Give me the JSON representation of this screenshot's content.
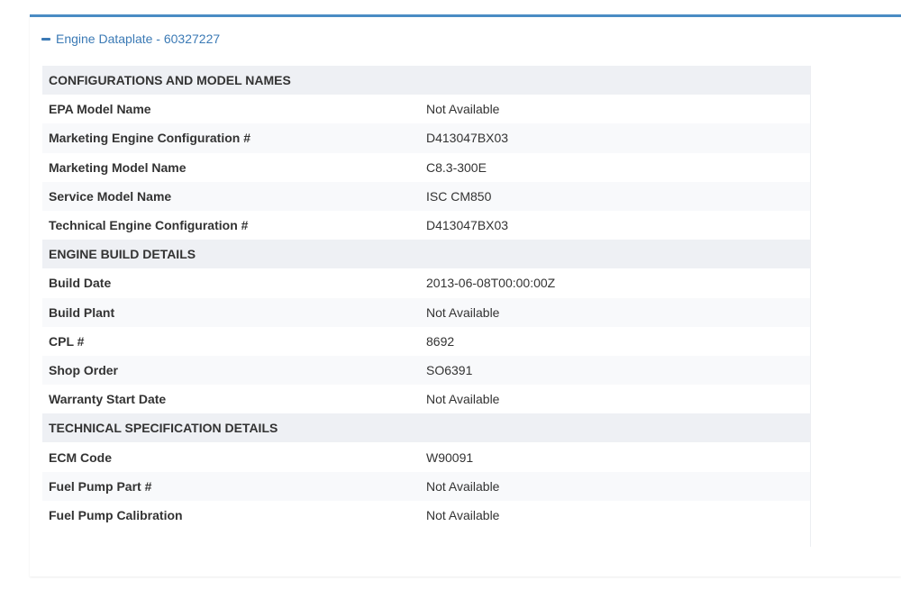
{
  "panel": {
    "title": "Engine Dataplate - 60327227",
    "expanded": true,
    "accent_color": "#4a8cc4"
  },
  "sections": [
    {
      "heading": "CONFIGURATIONS AND MODEL NAMES",
      "rows": [
        {
          "label": "EPA Model Name",
          "value": "Not Available"
        },
        {
          "label": "Marketing Engine Configuration #",
          "value": "D413047BX03"
        },
        {
          "label": "Marketing Model Name",
          "value": "C8.3-300E"
        },
        {
          "label": "Service Model Name",
          "value": "ISC CM850"
        },
        {
          "label": "Technical Engine Configuration #",
          "value": "D413047BX03"
        }
      ]
    },
    {
      "heading": "ENGINE BUILD DETAILS",
      "rows": [
        {
          "label": "Build Date",
          "value": "2013-06-08T00:00:00Z"
        },
        {
          "label": "Build Plant",
          "value": "Not Available"
        },
        {
          "label": "CPL #",
          "value": "8692"
        },
        {
          "label": "Shop Order",
          "value": "SO6391"
        },
        {
          "label": "Warranty Start Date",
          "value": "Not Available"
        }
      ]
    },
    {
      "heading": "TECHNICAL SPECIFICATION DETAILS",
      "rows": [
        {
          "label": "ECM Code",
          "value": "W90091"
        },
        {
          "label": "Fuel Pump Part #",
          "value": "Not Available"
        },
        {
          "label": "Fuel Pump Calibration",
          "value": "Not Available"
        }
      ]
    }
  ]
}
